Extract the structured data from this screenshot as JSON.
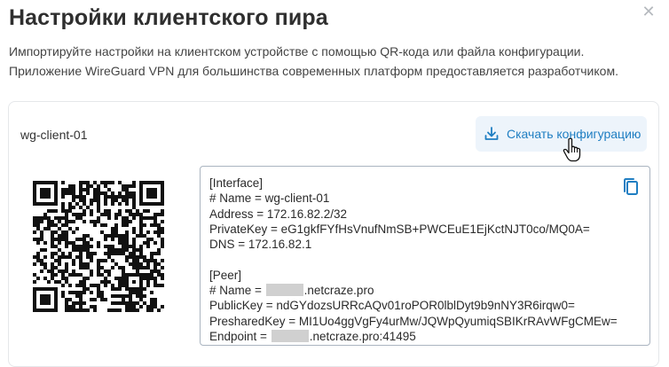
{
  "dialog": {
    "title": "Настройки клиентского пира",
    "subtitle_line1": "Импортируйте настройки на клиентском устройстве с помощью QR-кода или файла конфигурации.",
    "subtitle_line2": "Приложение WireGuard VPN для большинства современных платформ предоставляется разработчиком."
  },
  "peer": {
    "name": "wg-client-01",
    "download_label": "Скачать конфигурацию"
  },
  "config": {
    "interface_header": "[Interface]",
    "interface_name": "# Name = wg-client-01",
    "address": "Address = 172.16.82.2/32",
    "private_key": "PrivateKey = eG1gkfFYfHsVnufNmSB+PWCEuE1EjKctNJT0co/MQ0A=",
    "dns": "DNS = 172.16.82.1",
    "peer_header": "[Peer]",
    "peer_name_prefix": "# Name = ",
    "peer_name_suffix": ".netcraze.pro",
    "public_key": "PublicKey = ndGYdozsURRcAQv01roPOR0lblDyt9b9nNY3R6irqw0=",
    "preshared_key": "PresharedKey = MI1Uo4ggVgFy4urMw/JQWpQyumiqSBIKrRAvWFgCMEw=",
    "endpoint_prefix": "Endpoint = ",
    "endpoint_suffix": ".netcraze.pro:41495"
  },
  "icons": {
    "close": "close-icon",
    "download": "download-icon",
    "copy": "copy-icon",
    "cursor": "hand-pointer-cursor"
  },
  "colors": {
    "accent": "#1f7ec2",
    "button_bg": "#edf4fb"
  }
}
